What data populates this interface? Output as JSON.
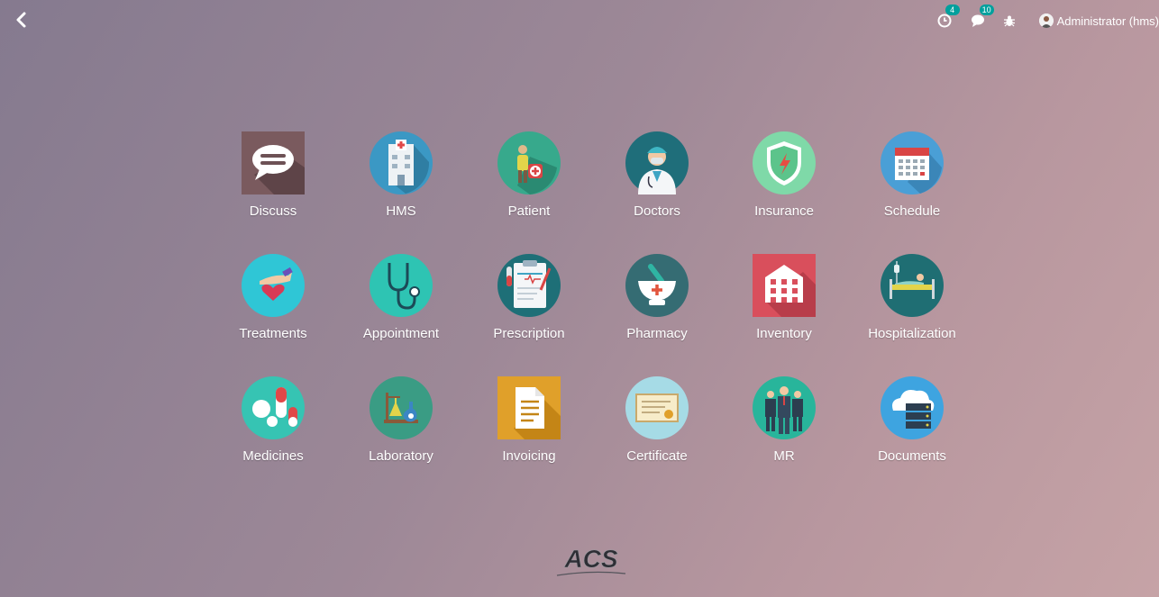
{
  "topbar": {
    "back_icon": "chevron-left-icon",
    "activity_count": "4",
    "messages_count": "10",
    "debug_icon": "bug-icon",
    "user_name": "Administrator (hms)"
  },
  "apps": [
    {
      "label": "Discuss",
      "icon": "chat-bubble-icon",
      "color": "#7a5a5e"
    },
    {
      "label": "HMS",
      "icon": "hospital-building-icon",
      "color": "#3b98c4"
    },
    {
      "label": "Patient",
      "icon": "patient-icon",
      "color": "#37a98c"
    },
    {
      "label": "Doctors",
      "icon": "doctor-icon",
      "color": "#1f6e7a"
    },
    {
      "label": "Insurance",
      "icon": "shield-icon",
      "color": "#7fd9a8"
    },
    {
      "label": "Schedule",
      "icon": "calendar-icon",
      "color": "#4a9fd6"
    },
    {
      "label": "Treatments",
      "icon": "heart-hand-icon",
      "color": "#2fc6d6"
    },
    {
      "label": "Appointment",
      "icon": "stethoscope-icon",
      "color": "#2ec4b3"
    },
    {
      "label": "Prescription",
      "icon": "clipboard-icon",
      "color": "#1e6f77"
    },
    {
      "label": "Pharmacy",
      "icon": "mortar-icon",
      "color": "#356c73"
    },
    {
      "label": "Inventory",
      "icon": "warehouse-icon",
      "color": "#d94f5c"
    },
    {
      "label": "Hospitalization",
      "icon": "hospital-bed-icon",
      "color": "#1f6e73"
    },
    {
      "label": "Medicines",
      "icon": "pills-icon",
      "color": "#36c4b3"
    },
    {
      "label": "Laboratory",
      "icon": "lab-flask-icon",
      "color": "#3a9c84"
    },
    {
      "label": "Invoicing",
      "icon": "document-icon",
      "color": "#e0a02a"
    },
    {
      "label": "Certificate",
      "icon": "certificate-icon",
      "color": "#a6dbe6"
    },
    {
      "label": "MR",
      "icon": "team-icon",
      "color": "#28b59b"
    },
    {
      "label": "Documents",
      "icon": "cloud-server-icon",
      "color": "#3ea4e0"
    }
  ],
  "footer": {
    "logo_text": "ACS"
  }
}
